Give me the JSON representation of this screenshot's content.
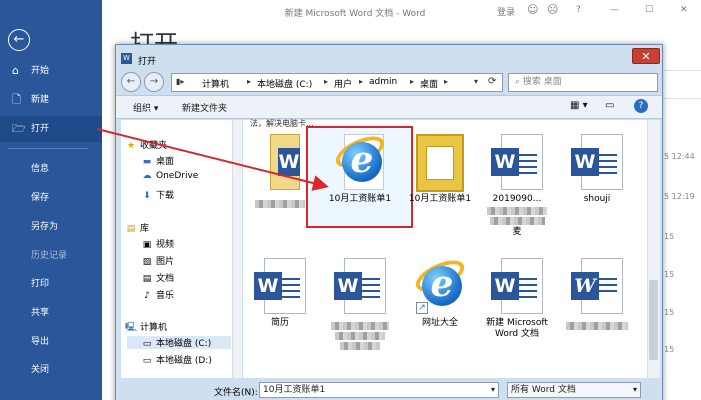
{
  "window": {
    "title": "新建 Microsoft Word 文档 - Word",
    "sign_in": "登录",
    "help": "?",
    "minimize": "—",
    "maximize": "☐",
    "close": "✕"
  },
  "backstage": {
    "page_title": "打开",
    "back_icon": "back-arrow-icon",
    "nav": [
      {
        "label": "开始",
        "icon": "home-icon"
      },
      {
        "label": "新建",
        "icon": "new-document-icon"
      },
      {
        "label": "打开",
        "icon": "open-folder-icon",
        "active": true
      },
      {
        "label": "信息"
      },
      {
        "label": "保存"
      },
      {
        "label": "另存为"
      },
      {
        "label": "历史记录",
        "dim": true
      },
      {
        "label": "打印"
      },
      {
        "label": "共享"
      },
      {
        "label": "导出"
      },
      {
        "label": "关闭"
      }
    ],
    "timestamps": [
      "5 12:44",
      "5 12:19",
      "15",
      "15",
      "15",
      "15"
    ]
  },
  "dialog": {
    "title": "打开",
    "close": "✕",
    "back": "←",
    "forward": "→",
    "breadcrumb": [
      "计算机",
      "本地磁盘 (C:)",
      "用户",
      "admin",
      "桌面"
    ],
    "search_placeholder": "搜索 桌面",
    "toolbar": {
      "organize": "组织 ▾",
      "new_folder": "新建文件夹",
      "help": "?"
    },
    "nav_pane": {
      "favorites": "收藏夹",
      "favorites_items": [
        "桌面",
        "OneDrive",
        "下载"
      ],
      "library": "库",
      "library_items": [
        "视频",
        "图片",
        "文档",
        "音乐"
      ],
      "computer": "计算机",
      "drives": [
        "本地磁盘 (C:)",
        "本地磁盘 (D:)"
      ]
    },
    "truncated_label": "法，解决电脑卡...",
    "files": [
      {
        "label": "",
        "kind": "word-partial",
        "blurred": true
      },
      {
        "label": "10月工资账单1",
        "kind": "ie",
        "selected": true
      },
      {
        "label": "10月工资账单1",
        "kind": "sheet"
      },
      {
        "label": "2019090...",
        "kind": "word",
        "blurred": true,
        "label_suffix": "麦"
      },
      {
        "label": "shouji",
        "kind": "word"
      },
      {
        "label": "简历",
        "kind": "word"
      },
      {
        "label": "",
        "kind": "word",
        "blurred": true
      },
      {
        "label": "网址大全",
        "kind": "ie-shortcut"
      },
      {
        "label": "新建 Microsoft Word 文档",
        "kind": "word"
      },
      {
        "label": "",
        "kind": "word-alt",
        "blurred": true
      }
    ],
    "filename_label": "文件名(N):",
    "filename_value": "10月工资账单1",
    "filetype_value": "所有 Word 文档"
  },
  "colors": {
    "word_blue": "#2b579a",
    "dialog_bg": "#cfdff0",
    "highlight_red": "#d9262a"
  }
}
